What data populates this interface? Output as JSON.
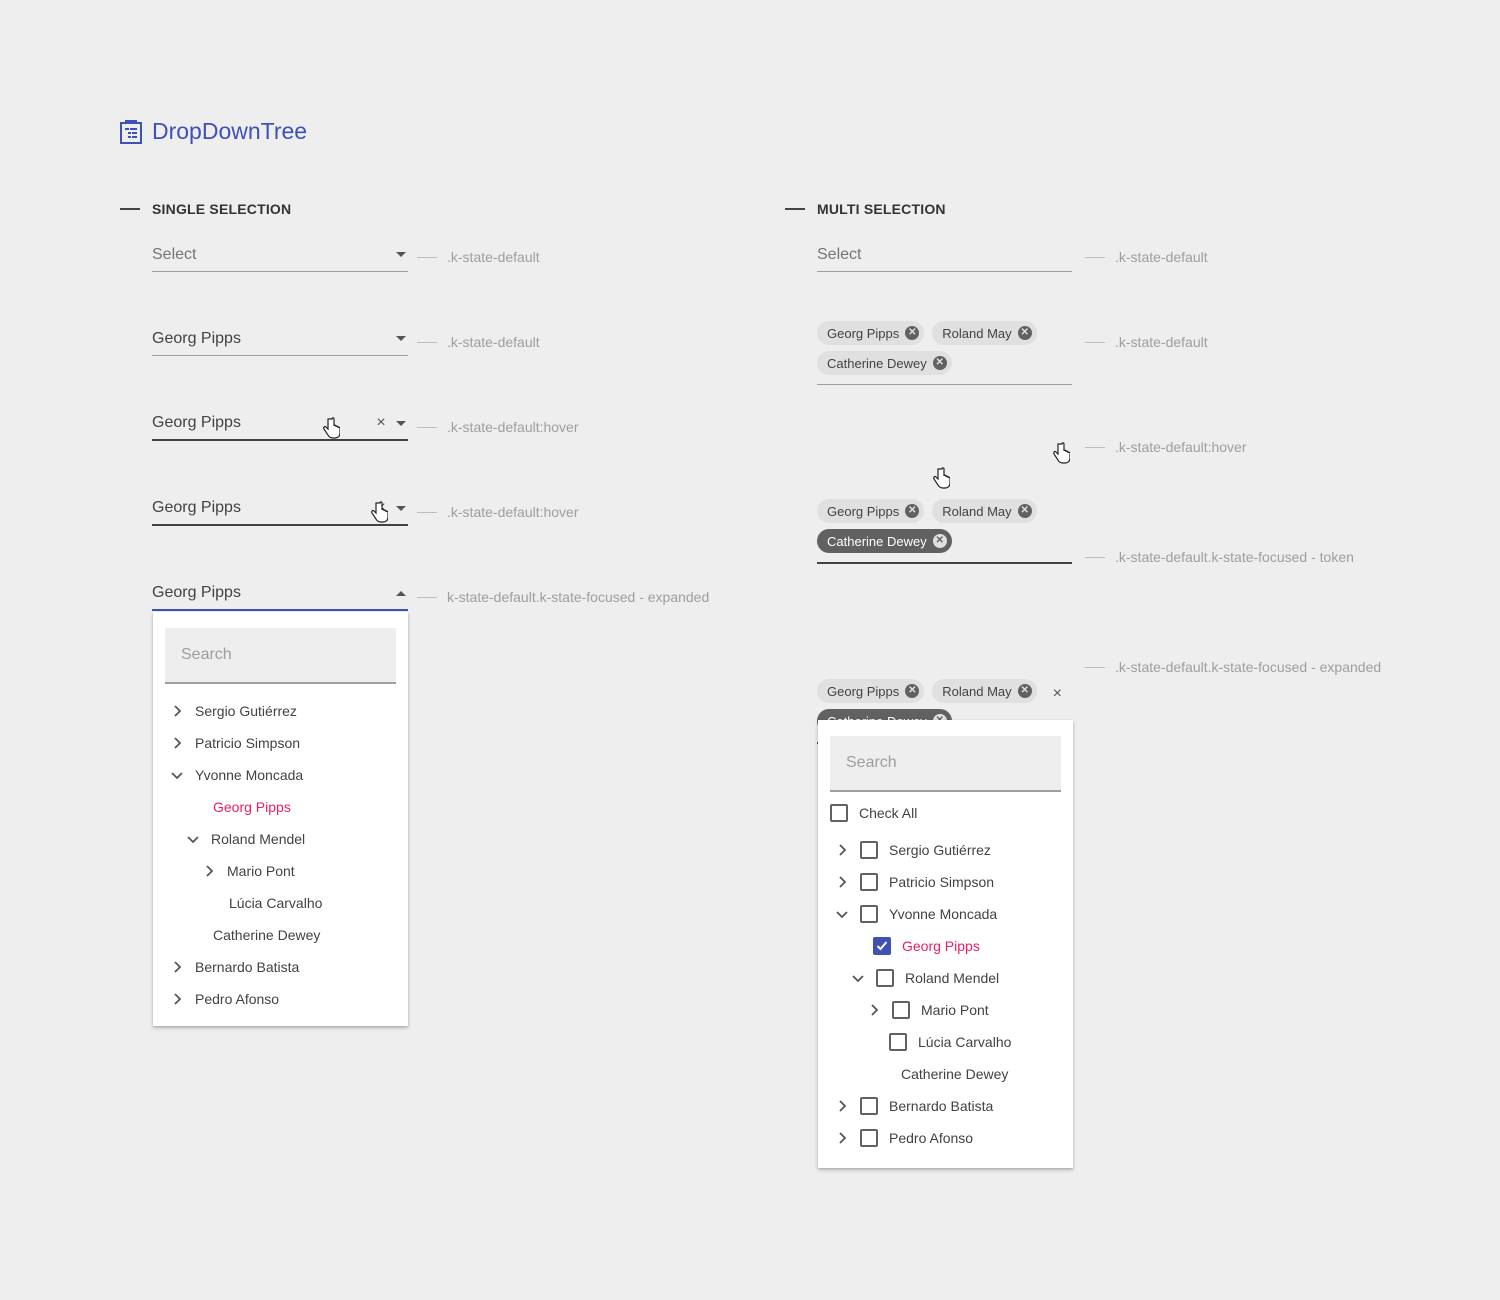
{
  "page": {
    "title": "DropDownTree"
  },
  "single": {
    "heading": "SINGLE SELECTION",
    "rows": [
      {
        "value": "Select",
        "note": ".k-state-default"
      },
      {
        "value": "Georg Pipps",
        "note": ".k-state-default"
      },
      {
        "value": "Georg Pipps",
        "note": ".k-state-default:hover"
      },
      {
        "value": "Georg Pipps",
        "note": ".k-state-default:hover"
      },
      {
        "value": "Georg Pipps",
        "note": "k-state-default.k-state-focused - expanded"
      }
    ],
    "clear_glyph": "×",
    "popup": {
      "search_placeholder": "Search",
      "items": [
        "Sergio Gutiérrez",
        "Patricio Simpson",
        "Yvonne Moncada",
        "Georg Pipps",
        "Roland Mendel",
        "Mario Pont",
        "Lúcia Carvalho",
        "Catherine Dewey",
        "Bernardo Batista",
        "Pedro Afonso"
      ]
    }
  },
  "multi": {
    "heading": "MULTI SELECTION",
    "placeholder": "Select",
    "tokens": [
      "Georg Pipps",
      "Roland May",
      "Catherine Dewey"
    ],
    "notes": [
      ".k-state-default",
      ".k-state-default",
      ".k-state-default:hover",
      ".k-state-default.k-state-focused - token",
      ".k-state-default.k-state-focused - expanded"
    ],
    "clear_glyph": "×",
    "popup": {
      "search_placeholder": "Search",
      "check_all": "Check All",
      "items": [
        "Sergio Gutiérrez",
        "Patricio Simpson",
        "Yvonne Moncada",
        "Georg Pipps",
        "Roland Mendel",
        "Mario Pont",
        "Lúcia Carvalho",
        "Catherine Dewey",
        "Bernardo Batista",
        "Pedro Afonso"
      ]
    }
  },
  "colors": {
    "accent": "#3f51b5",
    "selected_text": "#e91e63"
  },
  "icons": {
    "title": "dropdowntree-icon",
    "expand": "chevron-right-icon",
    "collapse": "chevron-down-icon",
    "token_remove": "x-circle-icon"
  }
}
